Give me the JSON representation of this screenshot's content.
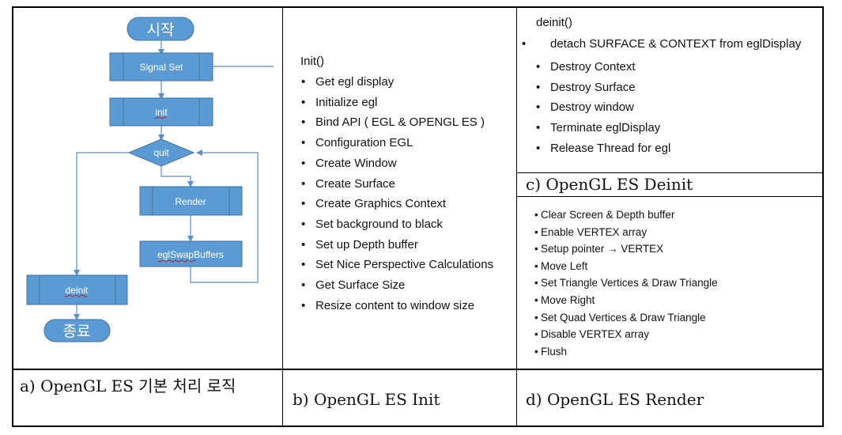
{
  "colors": {
    "shape_fill": "#5b9bd5",
    "shape_stroke": "#41719c",
    "connector": "#5b8fc9",
    "border": "#000000",
    "text": "#111111"
  },
  "flowchart": {
    "start": "시작",
    "signal_set": "Signal Set",
    "init": "init",
    "quit": "quit",
    "render": "Render",
    "swap": "eglSwapBuffers",
    "deinit": "deinit",
    "end": "종료"
  },
  "init_panel": {
    "heading": "Init()",
    "items": [
      "Get egl display",
      "Initialize egl",
      "Bind API ( EGL & OPENGL ES )",
      "Configuration EGL",
      "Create Window",
      "Create Surface",
      "Create Graphics Context",
      "Set background to black",
      "Set up Depth buffer",
      "Set Nice Perspective Calculations",
      "Get Surface Size",
      "Resize content to window size"
    ]
  },
  "deinit_panel": {
    "heading": "deinit()",
    "items": [
      "detach SURFACE & CONTEXT from eglDisplay",
      "Destroy Context",
      "Destroy Surface",
      "Destroy window",
      "Terminate eglDisplay",
      "Release Thread for egl"
    ]
  },
  "render_panel": {
    "items": [
      "Clear Screen & Depth buffer",
      "Enable VERTEX array",
      "Setup pointer → VERTEX",
      "Move Left",
      "Set Triangle Vertices  & Draw Triangle",
      "Move Right",
      "Set Quad Vertices & Draw Triangle",
      "Disable VERTEX array",
      "Flush"
    ]
  },
  "captions": {
    "a": "a) OpenGL ES 기본 처리 로직",
    "b": "b) OpenGL ES Init",
    "c": "c) OpenGL ES Deinit",
    "d": "d) OpenGL ES Render"
  }
}
